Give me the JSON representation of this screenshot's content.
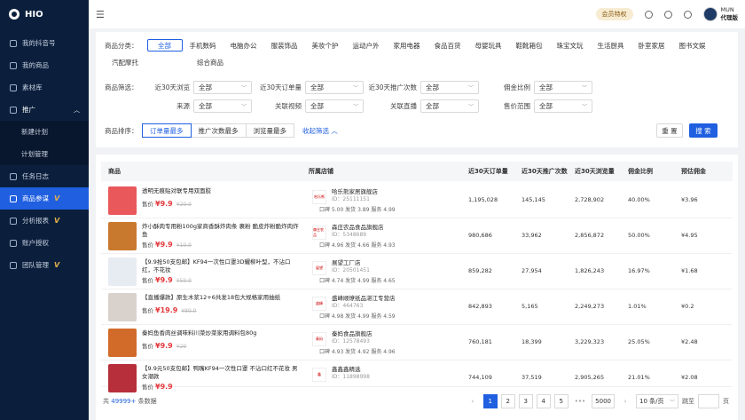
{
  "sidebar": {
    "brand": "HIO",
    "items": [
      {
        "label": "我的抖音号"
      },
      {
        "label": "我的商品"
      },
      {
        "label": "素材库"
      },
      {
        "label": "推广"
      },
      {
        "label": "新建计划"
      },
      {
        "label": "计划管理"
      },
      {
        "label": "任务日志"
      },
      {
        "label": "商品参谋"
      },
      {
        "label": "分析报表"
      },
      {
        "label": "账户授权"
      },
      {
        "label": "团队管理"
      }
    ],
    "vip_mark": "V"
  },
  "topbar": {
    "member_badge": "会员特权",
    "user_name": "MUN",
    "user_role": "代理版"
  },
  "filters": {
    "category_label": "商品分类：",
    "categories": [
      "全部",
      "手机数码",
      "电脑办公",
      "服装饰品",
      "美妆个护",
      "运动户外",
      "家用电器",
      "食品百货",
      "母婴玩具",
      "鞋靴箱包",
      "珠宝文玩",
      "生活厨具",
      "卧室家居",
      "图书文娱",
      "汽配摩托",
      "综合商品"
    ],
    "screen_label": "商品筛选：",
    "selects": [
      {
        "label": "近30天浏览",
        "value": "全部"
      },
      {
        "label": "近30天订单量",
        "value": "全部"
      },
      {
        "label": "近30天推广次数",
        "value": "全部"
      },
      {
        "label": "佣金比例",
        "value": "全部"
      },
      {
        "label": "来源",
        "value": "全部"
      },
      {
        "label": "关联视频",
        "value": "全部"
      },
      {
        "label": "关联直播",
        "value": "全部"
      },
      {
        "label": "售价范围",
        "value": "全部"
      }
    ],
    "sort_label": "商品排序：",
    "sorts": [
      "订单量最多",
      "推广次数最多",
      "浏览量最多"
    ],
    "collapse": "收起筛选 ︿",
    "reset": "重 置",
    "search": "搜 索"
  },
  "table": {
    "headers": [
      "商品",
      "所属店铺",
      "近30天订单量",
      "近30天推广次数",
      "近30天浏览量",
      "佣金比例",
      "预估佣金"
    ],
    "rows": [
      {
        "name": "透明无痕贴对联专用双面胶",
        "price_label": "售价",
        "price": "¥9.9",
        "orig": "¥29.9",
        "shop": "哈乐熊家居旗舰店",
        "shop_id": "ID：25111151",
        "score": "口碑 5.00  发货 3.89  服务 4.99",
        "orders": "1,195,028",
        "promos": "145,145",
        "views": "2,728,902",
        "rate": "40.00%",
        "commission": "¥3.96",
        "thumb": "#e9585b",
        "logo_text": "哈乐熊"
      },
      {
        "name": "炸小酥肉专用粉100g家商香酥炸肉条 裹粉 脆皮炸粉脆炸肉炸鱼",
        "price_label": "售价",
        "price": "¥9.9",
        "orig": "¥19.9",
        "shop": "森庄农品食品旗舰店",
        "shop_id": "ID：5348689",
        "score": "口碑 4.96  发货 4.66  服务 4.93",
        "orders": "980,686",
        "promos": "33,962",
        "views": "2,856,872",
        "rate": "50.00%",
        "commission": "¥4.95",
        "thumb": "#c9792e",
        "logo_text": "森庄农品"
      },
      {
        "name": "【9.9抢50支包邮】KF94一次性口罩3D耀柳叶型，不沾口红，不花妆",
        "price_label": "售价",
        "price": "¥9.9",
        "orig": "¥59.9",
        "shop": "展望工厂店",
        "shop_id": "ID：20501451",
        "score": "口碑 4.74  发货 4.99  服务 4.65",
        "orders": "859,282",
        "promos": "27,954",
        "views": "1,826,243",
        "rate": "16.97%",
        "commission": "¥1.68",
        "thumb": "#e7ecf2",
        "logo_text": "展望"
      },
      {
        "name": "【直播爆款】原生木浆12+6共发18包大规格家用抽纸",
        "price_label": "售价",
        "price": "¥19.9",
        "orig": "¥89.9",
        "shop": "盛峰顺燎纸品湛江专营店",
        "shop_id": "ID：464763",
        "score": "口碑 4.98  发货 4.99  服务 4.59",
        "orders": "842,893",
        "promos": "5,165",
        "views": "2,249,273",
        "rate": "1.01%",
        "commission": "¥0.2",
        "thumb": "#d9d2cc",
        "logo_text": "盛峰"
      },
      {
        "name": "秦妈鱼香肉丝调味料川菜炒菜家用调料包80g",
        "price_label": "售价",
        "price": "¥9.9",
        "orig": "¥29",
        "shop": "秦妈食品旗舰店",
        "shop_id": "ID：12578493",
        "score": "口碑 4.93  发货 4.92  服务 4.96",
        "orders": "760,181",
        "promos": "18,399",
        "views": "3,229,323",
        "rate": "25.05%",
        "commission": "¥2.48",
        "thumb": "#d26a2a",
        "logo_text": "秦妈"
      },
      {
        "name": "【9.9元50支包邮】鸭嘴KF94一次性口罩 不沾口红不花妆 男女潮款",
        "price_label": "售价",
        "price": "¥9.9",
        "orig": "",
        "shop": "鑫鑫鑫精选",
        "shop_id": "ID：11898998",
        "score": "",
        "orders": "744,109",
        "promos": "37,519",
        "views": "2,905,265",
        "rate": "21.01%",
        "commission": "¥2.08",
        "thumb": "#b72f3a",
        "logo_text": "鑫"
      }
    ]
  },
  "footer": {
    "total_prefix": "共",
    "total": "49999+",
    "total_suffix": "条数据",
    "pages": [
      "2",
      "3",
      "4",
      "5"
    ],
    "current_page": "1",
    "last_page": "5000",
    "page_size": "10 条/页",
    "jump_label": "跳至",
    "page_unit": "页"
  }
}
